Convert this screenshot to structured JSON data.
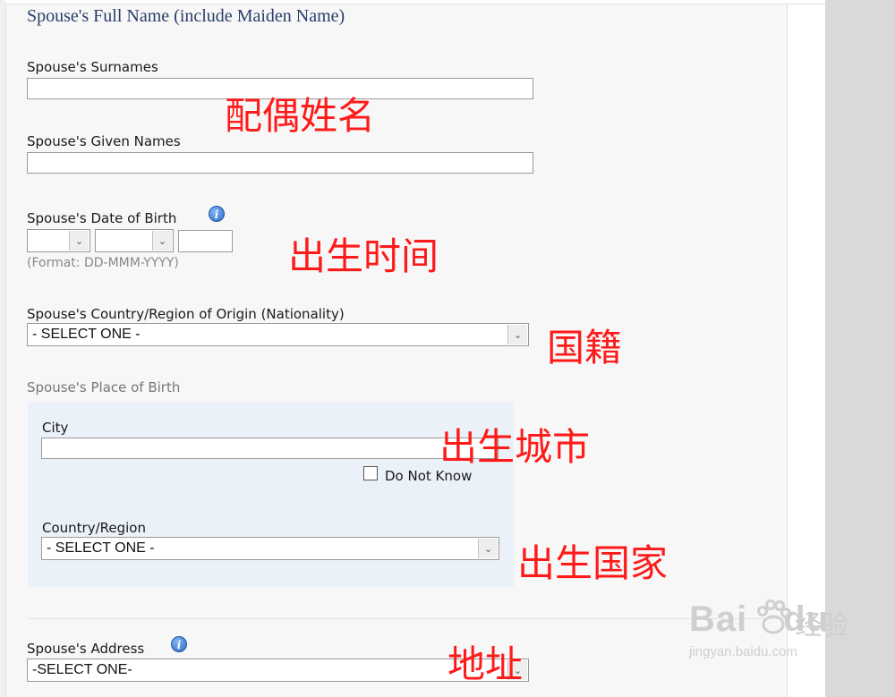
{
  "section_title": "Spouse's Full Name (include Maiden Name)",
  "surnames": {
    "label": "Spouse's Surnames",
    "value": ""
  },
  "given_names": {
    "label": "Spouse's Given Names",
    "value": ""
  },
  "dob": {
    "label": "Spouse's Date of Birth",
    "day_value": "",
    "month_value": "",
    "year_value": "",
    "format_hint": "(Format: DD-MMM-YYYY)",
    "info_icon": "info-icon"
  },
  "nationality": {
    "label": "Spouse's Country/Region of Origin (Nationality)",
    "selected": "- SELECT ONE -"
  },
  "place_of_birth": {
    "label": "Spouse's Place of Birth",
    "city_label": "City",
    "city_value": "",
    "do_not_know_label": "Do Not Know",
    "country_label": "Country/Region",
    "country_selected": "- SELECT ONE -"
  },
  "address": {
    "label": "Spouse's Address",
    "selected": "-SELECT ONE-",
    "info_icon": "info-icon"
  },
  "annotations": {
    "name": "配偶姓名",
    "dob": "出生时间",
    "nationality": "国籍",
    "city": "出生城市",
    "country": "出生国家",
    "address": "地址"
  },
  "watermark": {
    "brand_left": "Bai",
    "brand_right": "du",
    "brand_cn": "经验",
    "url": "jingyan.baidu.com"
  },
  "colors": {
    "annotation": "#ff1a1a",
    "title": "#2a3e6a",
    "pob_background": "#eaf1f8"
  }
}
